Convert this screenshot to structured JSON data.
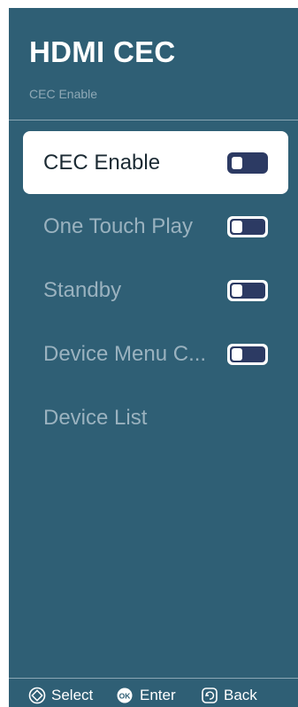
{
  "header": {
    "title": "HDMI CEC",
    "subtitle": "CEC Enable"
  },
  "menu": {
    "items": [
      {
        "label": "CEC Enable",
        "has_toggle": true,
        "toggle_state": "off",
        "selected": true
      },
      {
        "label": "One Touch Play",
        "has_toggle": true,
        "toggle_state": "off",
        "selected": false
      },
      {
        "label": "Standby",
        "has_toggle": true,
        "toggle_state": "off",
        "selected": false
      },
      {
        "label": "Device Menu C...",
        "has_toggle": true,
        "toggle_state": "off",
        "selected": false
      },
      {
        "label": "Device List",
        "has_toggle": false,
        "selected": false
      }
    ]
  },
  "footer": {
    "select_label": "Select",
    "select_icon": "dpad-icon",
    "enter_label": "Enter",
    "enter_icon_text": "OK",
    "back_label": "Back",
    "back_icon": "back-icon"
  },
  "colors": {
    "panel_bg": "#2f5f75",
    "selected_bg": "#ffffff",
    "toggle_dark": "#2c3a63",
    "dim_text": "#9ab2bf"
  }
}
